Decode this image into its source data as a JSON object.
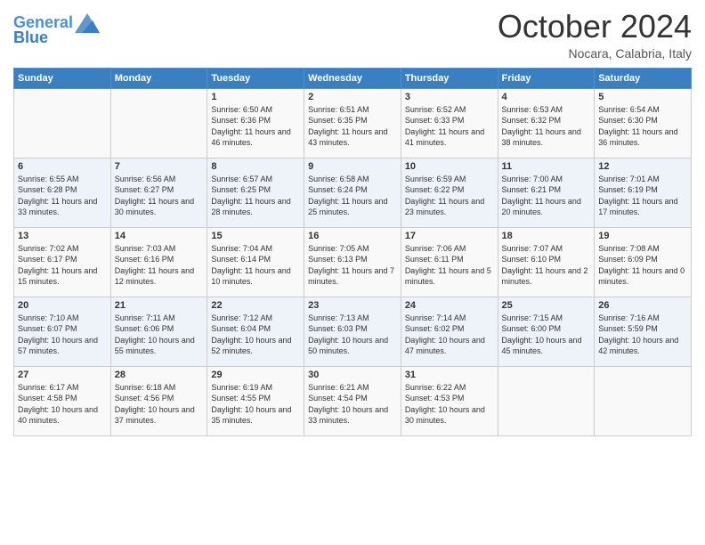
{
  "logo": {
    "line1": "General",
    "line2": "Blue"
  },
  "title": "October 2024",
  "location": "Nocara, Calabria, Italy",
  "weekdays": [
    "Sunday",
    "Monday",
    "Tuesday",
    "Wednesday",
    "Thursday",
    "Friday",
    "Saturday"
  ],
  "weeks": [
    [
      {
        "day": "",
        "info": ""
      },
      {
        "day": "",
        "info": ""
      },
      {
        "day": "1",
        "info": "Sunrise: 6:50 AM\nSunset: 6:36 PM\nDaylight: 11 hours and 46 minutes."
      },
      {
        "day": "2",
        "info": "Sunrise: 6:51 AM\nSunset: 6:35 PM\nDaylight: 11 hours and 43 minutes."
      },
      {
        "day": "3",
        "info": "Sunrise: 6:52 AM\nSunset: 6:33 PM\nDaylight: 11 hours and 41 minutes."
      },
      {
        "day": "4",
        "info": "Sunrise: 6:53 AM\nSunset: 6:32 PM\nDaylight: 11 hours and 38 minutes."
      },
      {
        "day": "5",
        "info": "Sunrise: 6:54 AM\nSunset: 6:30 PM\nDaylight: 11 hours and 36 minutes."
      }
    ],
    [
      {
        "day": "6",
        "info": "Sunrise: 6:55 AM\nSunset: 6:28 PM\nDaylight: 11 hours and 33 minutes."
      },
      {
        "day": "7",
        "info": "Sunrise: 6:56 AM\nSunset: 6:27 PM\nDaylight: 11 hours and 30 minutes."
      },
      {
        "day": "8",
        "info": "Sunrise: 6:57 AM\nSunset: 6:25 PM\nDaylight: 11 hours and 28 minutes."
      },
      {
        "day": "9",
        "info": "Sunrise: 6:58 AM\nSunset: 6:24 PM\nDaylight: 11 hours and 25 minutes."
      },
      {
        "day": "10",
        "info": "Sunrise: 6:59 AM\nSunset: 6:22 PM\nDaylight: 11 hours and 23 minutes."
      },
      {
        "day": "11",
        "info": "Sunrise: 7:00 AM\nSunset: 6:21 PM\nDaylight: 11 hours and 20 minutes."
      },
      {
        "day": "12",
        "info": "Sunrise: 7:01 AM\nSunset: 6:19 PM\nDaylight: 11 hours and 17 minutes."
      }
    ],
    [
      {
        "day": "13",
        "info": "Sunrise: 7:02 AM\nSunset: 6:17 PM\nDaylight: 11 hours and 15 minutes."
      },
      {
        "day": "14",
        "info": "Sunrise: 7:03 AM\nSunset: 6:16 PM\nDaylight: 11 hours and 12 minutes."
      },
      {
        "day": "15",
        "info": "Sunrise: 7:04 AM\nSunset: 6:14 PM\nDaylight: 11 hours and 10 minutes."
      },
      {
        "day": "16",
        "info": "Sunrise: 7:05 AM\nSunset: 6:13 PM\nDaylight: 11 hours and 7 minutes."
      },
      {
        "day": "17",
        "info": "Sunrise: 7:06 AM\nSunset: 6:11 PM\nDaylight: 11 hours and 5 minutes."
      },
      {
        "day": "18",
        "info": "Sunrise: 7:07 AM\nSunset: 6:10 PM\nDaylight: 11 hours and 2 minutes."
      },
      {
        "day": "19",
        "info": "Sunrise: 7:08 AM\nSunset: 6:09 PM\nDaylight: 11 hours and 0 minutes."
      }
    ],
    [
      {
        "day": "20",
        "info": "Sunrise: 7:10 AM\nSunset: 6:07 PM\nDaylight: 10 hours and 57 minutes."
      },
      {
        "day": "21",
        "info": "Sunrise: 7:11 AM\nSunset: 6:06 PM\nDaylight: 10 hours and 55 minutes."
      },
      {
        "day": "22",
        "info": "Sunrise: 7:12 AM\nSunset: 6:04 PM\nDaylight: 10 hours and 52 minutes."
      },
      {
        "day": "23",
        "info": "Sunrise: 7:13 AM\nSunset: 6:03 PM\nDaylight: 10 hours and 50 minutes."
      },
      {
        "day": "24",
        "info": "Sunrise: 7:14 AM\nSunset: 6:02 PM\nDaylight: 10 hours and 47 minutes."
      },
      {
        "day": "25",
        "info": "Sunrise: 7:15 AM\nSunset: 6:00 PM\nDaylight: 10 hours and 45 minutes."
      },
      {
        "day": "26",
        "info": "Sunrise: 7:16 AM\nSunset: 5:59 PM\nDaylight: 10 hours and 42 minutes."
      }
    ],
    [
      {
        "day": "27",
        "info": "Sunrise: 6:17 AM\nSunset: 4:58 PM\nDaylight: 10 hours and 40 minutes."
      },
      {
        "day": "28",
        "info": "Sunrise: 6:18 AM\nSunset: 4:56 PM\nDaylight: 10 hours and 37 minutes."
      },
      {
        "day": "29",
        "info": "Sunrise: 6:19 AM\nSunset: 4:55 PM\nDaylight: 10 hours and 35 minutes."
      },
      {
        "day": "30",
        "info": "Sunrise: 6:21 AM\nSunset: 4:54 PM\nDaylight: 10 hours and 33 minutes."
      },
      {
        "day": "31",
        "info": "Sunrise: 6:22 AM\nSunset: 4:53 PM\nDaylight: 10 hours and 30 minutes."
      },
      {
        "day": "",
        "info": ""
      },
      {
        "day": "",
        "info": ""
      }
    ]
  ]
}
